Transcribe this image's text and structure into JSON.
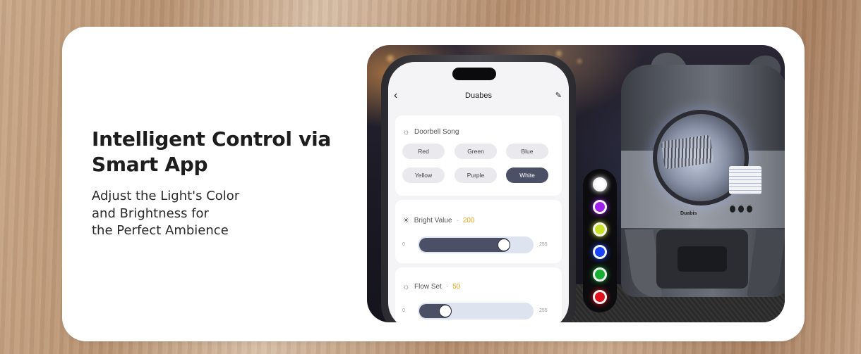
{
  "hero": {
    "title": "Intelligent Control via Smart App",
    "subtitle": "Adjust the Light's Color\nand Brightness for\nthe Perfect Ambience"
  },
  "phone": {
    "back_icon": "chevron-left-icon",
    "title": "Duabes",
    "edit_icon": "pencil-icon",
    "doorbell": {
      "label": "Doorbell Song",
      "icon": "sun-icon",
      "options": [
        "Red",
        "Green",
        "Blue",
        "Yellow",
        "Purple",
        "White"
      ],
      "selected": "White"
    },
    "bright": {
      "label": "Bright Value",
      "separator": "·",
      "value": "200",
      "icon": "lamp-icon",
      "min": "0",
      "max": "255",
      "level": 0.784
    },
    "flow": {
      "label": "Flow Set",
      "separator": "·",
      "value": "50",
      "icon": "sun-icon",
      "min": "0",
      "max": "255",
      "level": 0.196
    }
  },
  "device": {
    "brand": "Duabis",
    "led_colors": [
      "#ffffff",
      "#a020f0",
      "#c8e02a",
      "#1a44ff",
      "#17b032",
      "#e0101c"
    ]
  },
  "colors": {
    "accent": "#f0a21a",
    "slider_fill": "#4c5066",
    "slider_track": "#dde3ef",
    "chip_bg": "#e9e9ee"
  }
}
